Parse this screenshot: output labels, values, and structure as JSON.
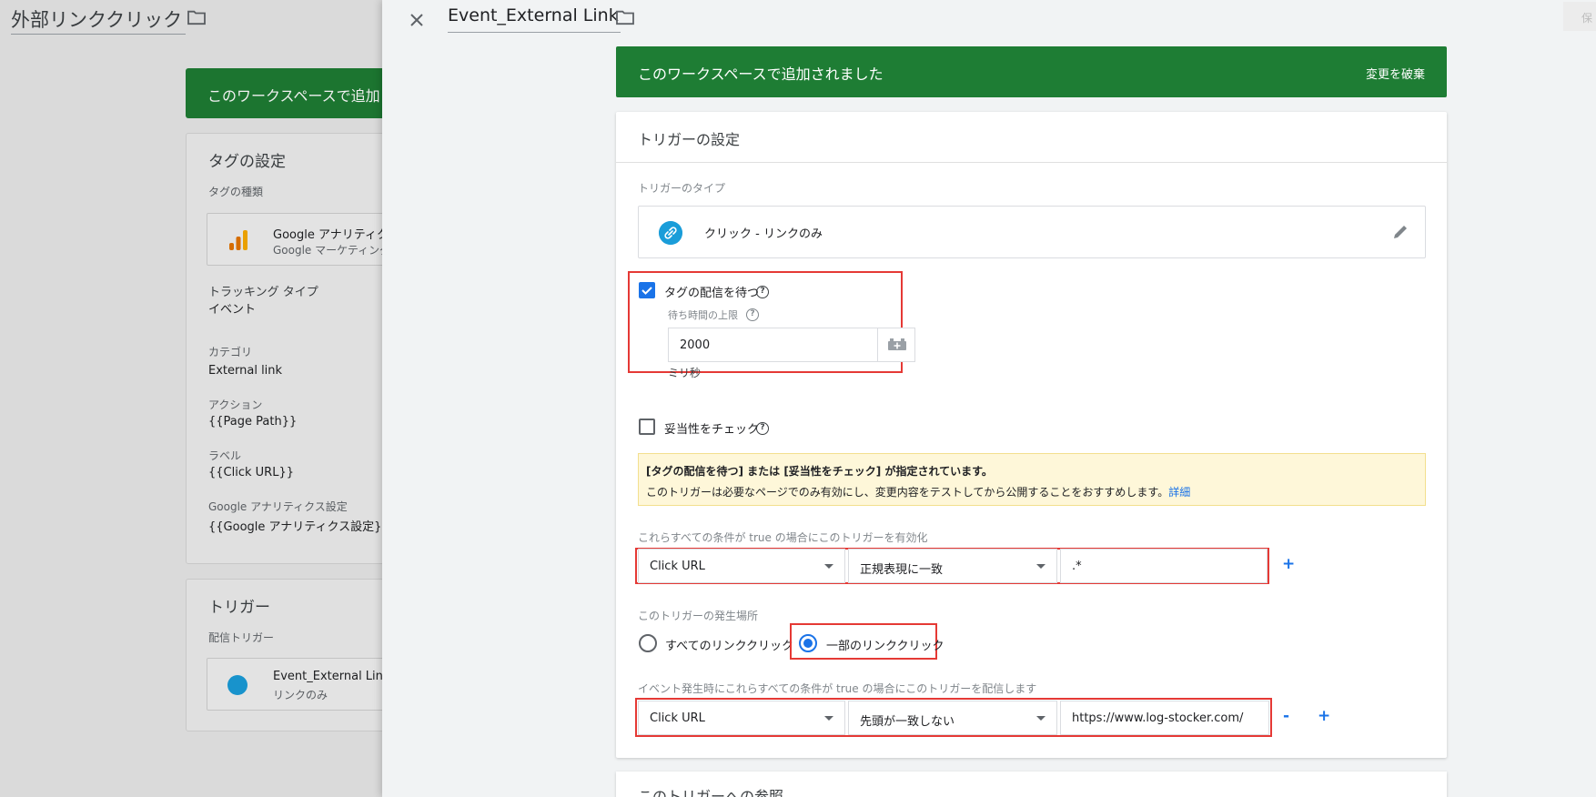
{
  "background": {
    "title": "外部リンククリック",
    "banner": "このワークスペースで追加",
    "tag_settings": {
      "heading": "タグの設定",
      "tag_type_label": "タグの種類",
      "tag_name": "Google アナリティクス",
      "tag_vendor": "Google マーケティング",
      "tracking_type_label": "トラッキング タイプ",
      "tracking_type": "イベント",
      "category_label": "カテゴリ",
      "category": "External link",
      "action_label": "アクション",
      "action": "{{Page Path}}",
      "label_label": "ラベル",
      "label": "{{Click URL}}",
      "ga_settings_label": "Google アナリティクス設定",
      "ga_settings": "{{Google アナリティクス設定}}"
    },
    "trigger": {
      "heading": "トリガー",
      "firing_label": "配信トリガー",
      "name": "Event_External Link",
      "type": "リンクのみ"
    }
  },
  "panel": {
    "title": "Event_External Link",
    "save_label": "保",
    "banner": {
      "message": "このワークスペースで追加されました",
      "discard": "変更を破棄"
    },
    "trigger_config": {
      "heading": "トリガーの設定",
      "type_label": "トリガーのタイプ",
      "type_value": "クリック - リンクのみ",
      "wait_for_tags": {
        "label": "タグの配信を待つ",
        "checked": true,
        "max_wait_label": "待ち時間の上限",
        "max_wait_value": "2000",
        "unit": "ミリ秒"
      },
      "check_validation": {
        "label": "妥当性をチェック",
        "checked": false
      },
      "warning": {
        "title": "[タグの配信を待つ] または [妥当性をチェック] が指定されています。",
        "body": "このトリガーは必要なページでのみ有効にし、変更内容をテストしてから公開することをおすすめします。",
        "link": "詳細"
      },
      "enable_condition": {
        "label": "これらすべての条件が true の場合にこのトリガーを有効化",
        "variable": "Click URL",
        "operator": "正規表現に一致",
        "value": ".*",
        "add": "+"
      },
      "fires_on": {
        "label": "このトリガーの発生場所",
        "options": [
          "すべてのリンククリック",
          "一部のリンククリック"
        ],
        "selected": "一部のリンククリック"
      },
      "fire_condition": {
        "label": "イベント発生時にこれらすべての条件が true の場合にこのトリガーを配信します",
        "variable": "Click URL",
        "operator": "先頭が一致しない",
        "value": "https://www.log-stocker.com/",
        "remove": "-",
        "add": "+"
      }
    },
    "references": {
      "heading": "このトリガーへの参照"
    }
  },
  "colors": {
    "green_banner": "#1e7d34",
    "accent_blue": "#1a73e8",
    "highlight_red": "#e53935",
    "warning_bg": "#fef7d9"
  }
}
